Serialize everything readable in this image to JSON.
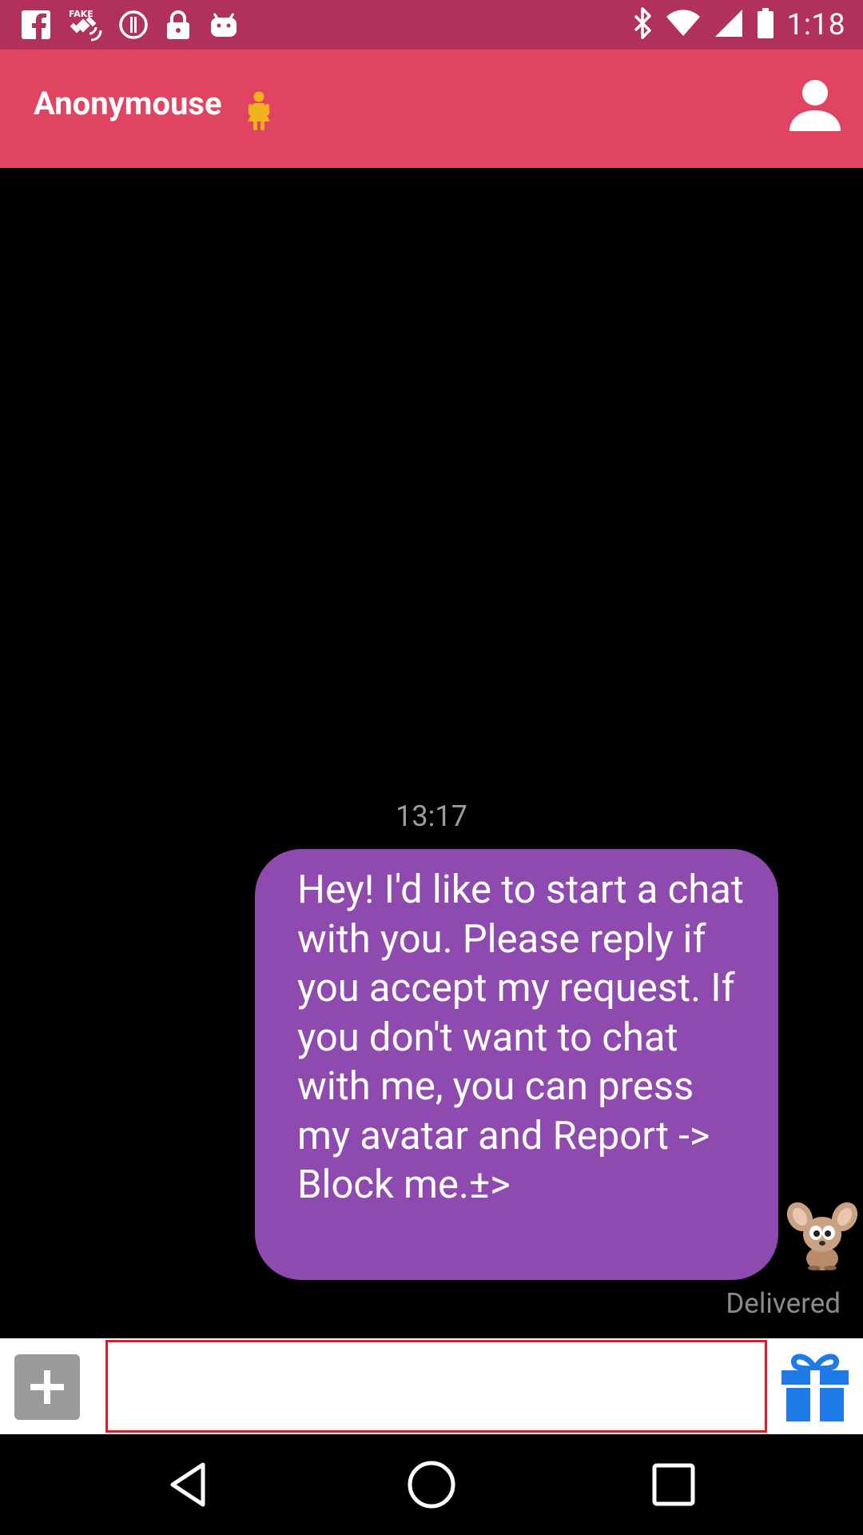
{
  "status_bar": {
    "time": "1:18",
    "left_icons": [
      "facebook-icon",
      "fake-gps-icon",
      "alert-circle-icon",
      "lock-icon",
      "android-icon"
    ],
    "right_icons": [
      "bluetooth-icon",
      "wifi-icon",
      "signal-icon",
      "battery-icon"
    ]
  },
  "app_bar": {
    "title": "Anonymouse",
    "gender_icon": "female-figure-icon",
    "profile_icon": "person-icon",
    "color": "#e04460"
  },
  "chat": {
    "timestamp": "13:17",
    "message": "Hey! I'd like to start a chat with you. Please reply if you accept my request. If you don't want to chat with me, you can press my avatar and Report -> Block me.±>",
    "bubble_color": "#8e4aaf",
    "status": "Delivered",
    "avatar": "mouse-avatar-icon"
  },
  "input": {
    "placeholder": "",
    "value": "",
    "attach_icon": "plus-icon",
    "gift_icon": "gift-icon"
  },
  "nav": {
    "back_icon": "back-triangle-icon",
    "home_icon": "home-circle-icon",
    "recents_icon": "recents-square-icon"
  }
}
